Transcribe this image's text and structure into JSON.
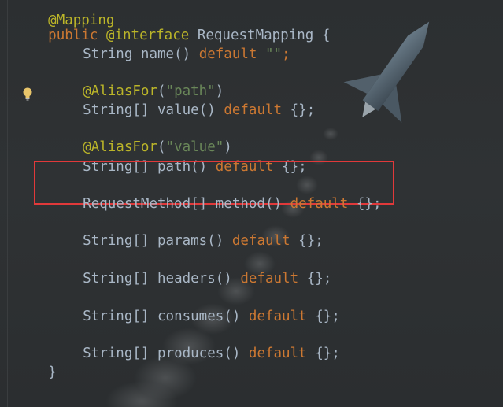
{
  "code": {
    "line0": "@Mapping",
    "line1": {
      "kw": "public",
      "ann": "@interface",
      "name": "RequestMapping",
      "brace": "{"
    },
    "line2": {
      "type": "String",
      "member": "name()",
      "kw": "default",
      "str": "\"\"",
      "end": ";"
    },
    "line3": {
      "ann": "@AliasFor",
      "open": "(",
      "str": "\"path\"",
      "close": ")"
    },
    "line4": {
      "type": "String[]",
      "member": "value()",
      "kw": "default",
      "end": "{};"
    },
    "line5": {
      "ann": "@AliasFor",
      "open": "(",
      "str": "\"value\"",
      "close": ")"
    },
    "line6": {
      "type": "String[]",
      "member": "path()",
      "kw": "default",
      "end": "{};"
    },
    "line7": {
      "type": "RequestMethod[]",
      "member": "method()",
      "kw": "default",
      "end": "{};"
    },
    "line8": {
      "type": "String[]",
      "member": "params()",
      "kw": "default",
      "end": "{};"
    },
    "line9": {
      "type": "String[]",
      "member": "headers()",
      "kw": "default",
      "end": "{};"
    },
    "line10": {
      "type": "String[]",
      "member": "consumes()",
      "kw": "default",
      "end": "{};"
    },
    "line11": {
      "type": "String[]",
      "member": "produces()",
      "kw": "default",
      "end": "{};"
    },
    "line12": "}"
  },
  "icons": {
    "bulb": "lightbulb-icon"
  },
  "colors": {
    "background": "#2b2d2f",
    "keyword": "#cc7832",
    "annotation": "#bbb529",
    "string": "#6a8759",
    "text": "#a9b7c6",
    "highlight_border": "#e1393a",
    "bulb": "#e8c46a"
  }
}
